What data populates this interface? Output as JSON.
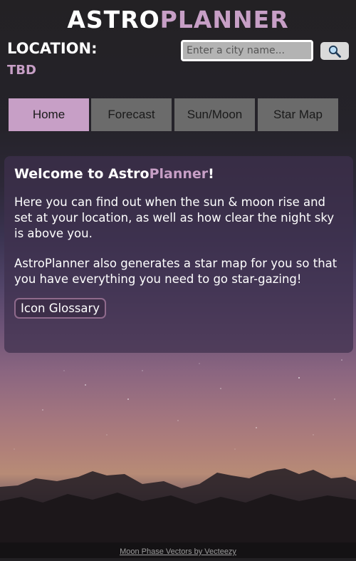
{
  "header": {
    "title_part1": "ASTRO",
    "title_part2": "PLANNER",
    "location_label": "LOCATION:",
    "location_value": "TBD"
  },
  "search": {
    "placeholder": "Enter a city name...",
    "button_icon": "search-icon"
  },
  "tabs": [
    {
      "label": "Home",
      "active": true
    },
    {
      "label": "Forecast",
      "active": false
    },
    {
      "label": "Sun/Moon",
      "active": false
    },
    {
      "label": "Star Map",
      "active": false
    }
  ],
  "welcome": {
    "heading_prefix": "Welcome to Astro",
    "heading_accent": "Planner",
    "heading_suffix": "!",
    "paragraph1": "Here you can find out when the sun & moon rise and set at your location, as well as how clear the night sky is above you.",
    "paragraph2": "AstroPlanner also generates a star map for you so that you have everything you need to go star-gazing!",
    "glossary_button": "Icon Glossary"
  },
  "footer": {
    "credit_link": "Moon Phase Vectors by Vecteezy"
  },
  "colors": {
    "accent": "#c79fc6",
    "tab_inactive": "#6b6b6b",
    "header_bg": "#232124"
  }
}
